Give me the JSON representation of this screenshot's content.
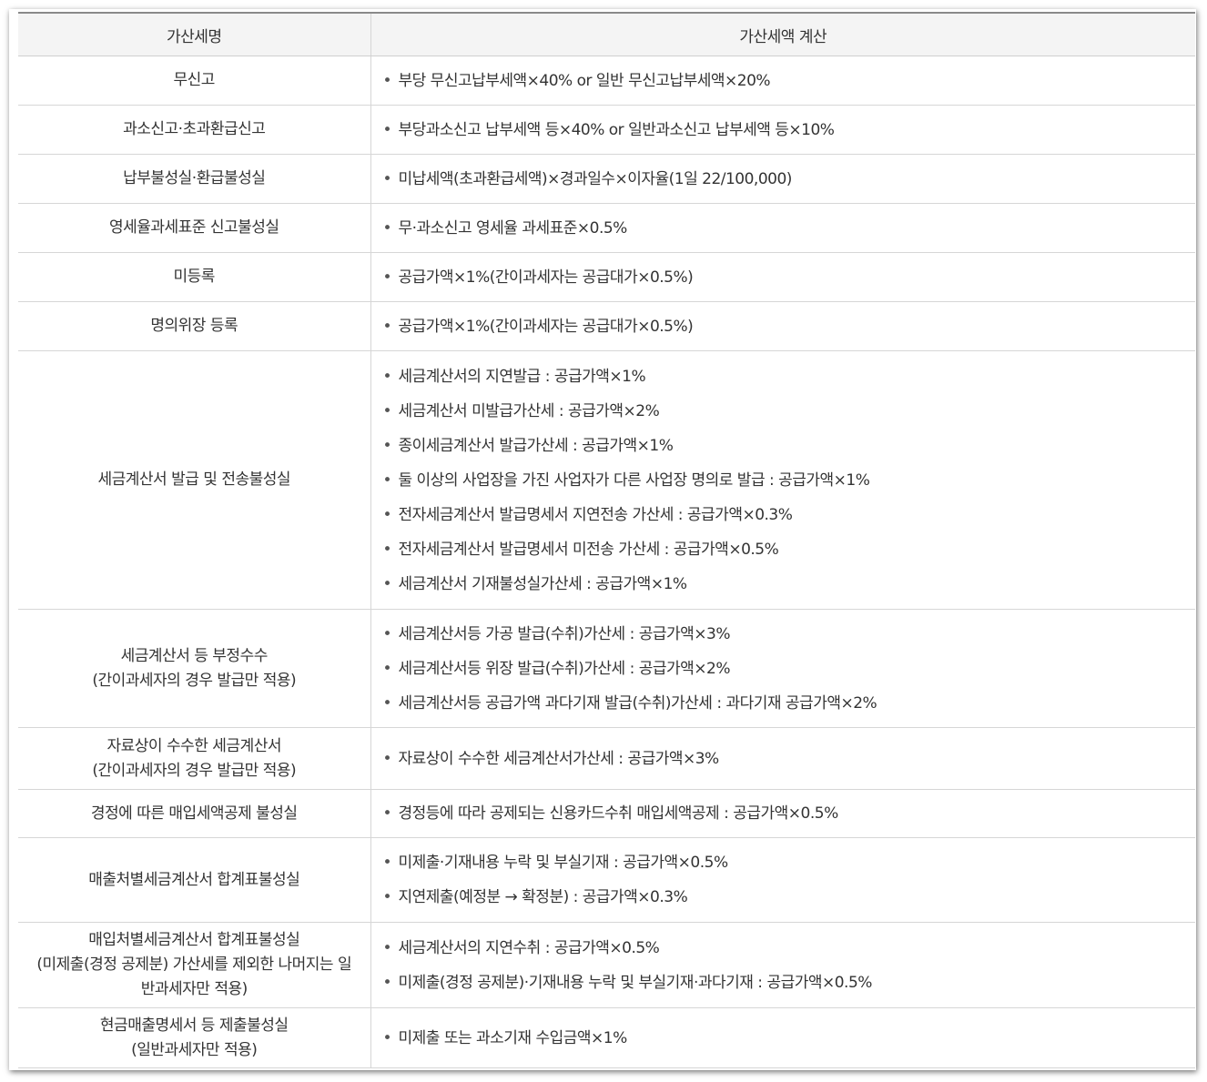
{
  "header": {
    "col1": "가산세명",
    "col2": "가산세액 계산"
  },
  "rows": [
    {
      "name": "무신고",
      "name_sub": "",
      "items": [
        "부당 무신고납부세액×40% or 일반 무신고납부세액×20%"
      ]
    },
    {
      "name": "과소신고·초과환급신고",
      "name_sub": "",
      "items": [
        "부당과소신고 납부세액 등×40% or 일반과소신고 납부세액 등×10%"
      ]
    },
    {
      "name": "납부불성실·환급불성실",
      "name_sub": "",
      "items": [
        "미납세액(초과환급세액)×경과일수×이자율(1일 22/100,000)"
      ]
    },
    {
      "name": "영세율과세표준 신고불성실",
      "name_sub": "",
      "items": [
        "무·과소신고 영세율 과세표준×0.5%"
      ]
    },
    {
      "name": "미등록",
      "name_sub": "",
      "items": [
        "공급가액×1%(간이과세자는 공급대가×0.5%)"
      ]
    },
    {
      "name": "명의위장 등록",
      "name_sub": "",
      "items": [
        "공급가액×1%(간이과세자는 공급대가×0.5%)"
      ]
    },
    {
      "name": "세금계산서 발급 및 전송불성실",
      "name_sub": "",
      "items": [
        "세금계산서의 지연발급 : 공급가액×1%",
        "세금계산서 미발급가산세 : 공급가액×2%",
        "종이세금계산서 발급가산세 : 공급가액×1%",
        "둘 이상의 사업장을 가진 사업자가 다른 사업장 명의로 발급 : 공급가액×1%",
        "전자세금계산서 발급명세서 지연전송 가산세 : 공급가액×0.3%",
        "전자세금계산서 발급명세서 미전송 가산세 : 공급가액×0.5%",
        "세금계산서 기재불성실가산세 : 공급가액×1%"
      ]
    },
    {
      "name": "세금계산서 등 부정수수",
      "name_sub": "(간이과세자의 경우 발급만 적용)",
      "items": [
        "세금계산서등 가공 발급(수취)가산세 : 공급가액×3%",
        "세금계산서등 위장 발급(수취)가산세 : 공급가액×2%",
        "세금계산서등 공급가액 과다기재 발급(수취)가산세 : 과다기재 공급가액×2%"
      ]
    },
    {
      "name": "자료상이 수수한 세금계산서",
      "name_sub": "(간이과세자의 경우 발급만 적용)",
      "items": [
        "자료상이 수수한 세금계산서가산세 : 공급가액×3%"
      ]
    },
    {
      "name": "경정에 따른 매입세액공제 불성실",
      "name_sub": "",
      "items": [
        "경정등에 따라 공제되는 신용카드수취 매입세액공제 : 공급가액×0.5%"
      ]
    },
    {
      "name": "매출처별세금계산서 합계표불성실",
      "name_sub": "",
      "items": [
        "미제출·기재내용 누락 및 부실기재 : 공급가액×0.5%",
        "지연제출(예정분 → 확정분) : 공급가액×0.3%"
      ]
    },
    {
      "name": "매입처별세금계산서 합계표불성실",
      "name_sub": "(미제출(경정 공제분) 가산세를 제외한 나머지는 일반과세자만 적용)",
      "items": [
        "세금계산서의 지연수취 : 공급가액×0.5%",
        "미제출(경정 공제분)·기재내용 누락 및 부실기재·과다기재 : 공급가액×0.5%"
      ]
    },
    {
      "name": "현금매출명세서 등 제출불성실",
      "name_sub": "(일반과세자만 적용)",
      "items": [
        "미제출 또는 과소기재 수입금액×1%"
      ]
    }
  ],
  "bullet_glyph": "•"
}
